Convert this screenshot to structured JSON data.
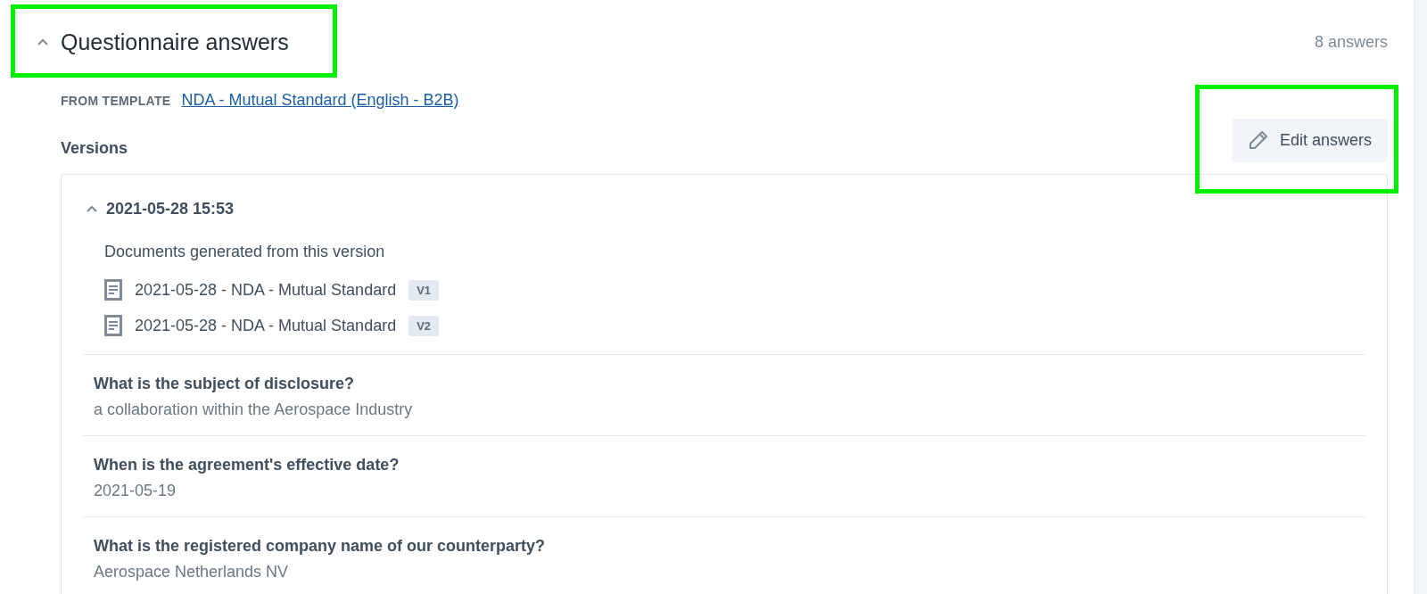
{
  "section": {
    "title": "Questionnaire answers",
    "expanded": true,
    "count": "8 answers"
  },
  "template": {
    "label": "FROM TEMPLATE",
    "link": "NDA - Mutual Standard (English - B2B)"
  },
  "versions_label": "Versions",
  "edit_button": "Edit answers",
  "versions": [
    {
      "timestamp": "2021-05-28 15:53",
      "expanded": true,
      "documents_heading": "Documents generated from this version",
      "documents": [
        {
          "name": "2021-05-28 - NDA - Mutual Standard",
          "badge": "V1"
        },
        {
          "name": "2021-05-28 - NDA - Mutual Standard",
          "badge": "V2"
        }
      ],
      "answers": [
        {
          "question": "What is the subject of disclosure?",
          "answer": "a collaboration within the Aerospace Industry"
        },
        {
          "question": "When is the agreement's effective date?",
          "answer": "2021-05-19"
        },
        {
          "question": "What is the registered company name of our counterparty?",
          "answer": "Aerospace Netherlands NV"
        }
      ]
    }
  ]
}
